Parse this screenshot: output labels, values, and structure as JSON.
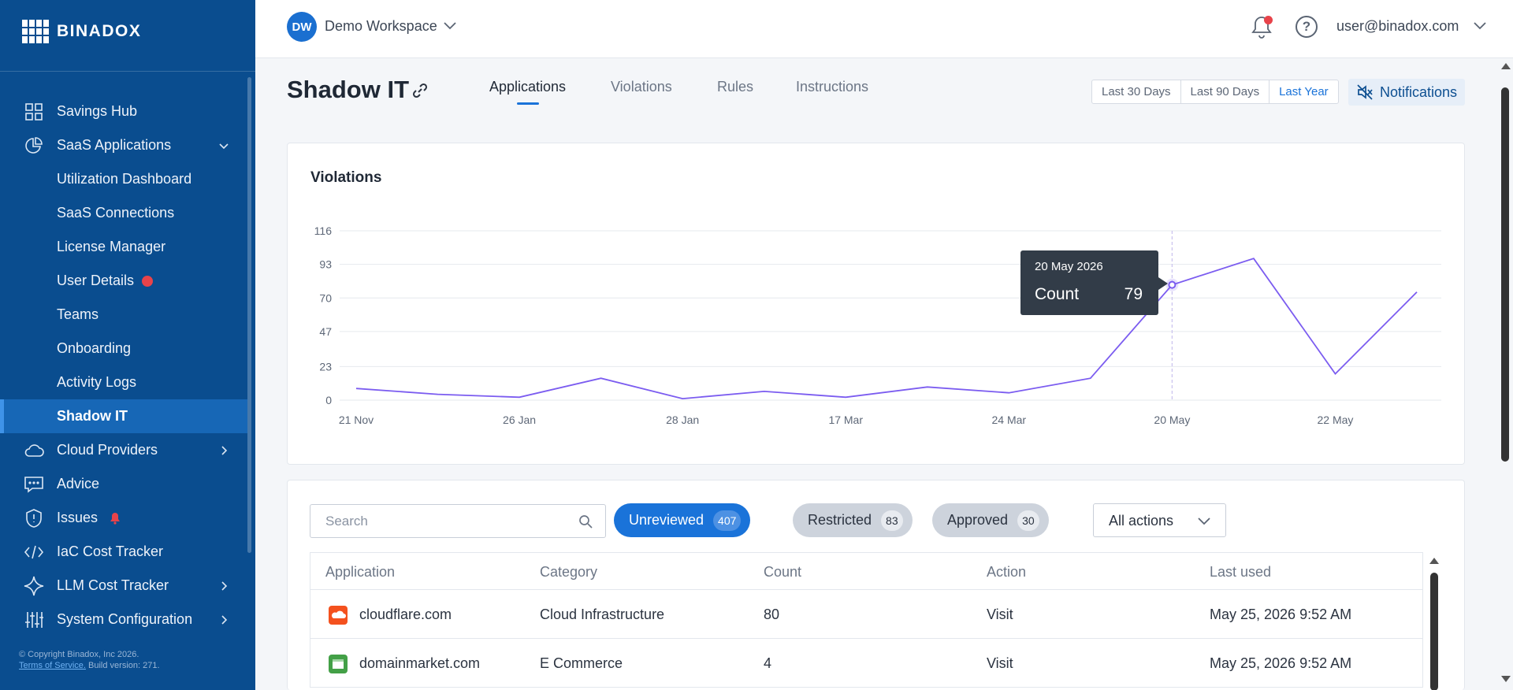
{
  "brand": {
    "name": "BINADOX"
  },
  "sidebar": {
    "items": [
      {
        "label": "Savings Hub",
        "icon": "grid-icon"
      },
      {
        "label": "SaaS Applications",
        "icon": "pie-chart-icon",
        "expanded": true
      },
      {
        "label": "Utilization Dashboard"
      },
      {
        "label": "SaaS Connections"
      },
      {
        "label": "License Manager"
      },
      {
        "label": "User Details",
        "badge": "red-dot"
      },
      {
        "label": "Teams"
      },
      {
        "label": "Onboarding"
      },
      {
        "label": "Activity Logs"
      },
      {
        "label": "Shadow IT",
        "active": true
      },
      {
        "label": "Cloud Providers",
        "icon": "cloud-icon"
      },
      {
        "label": "Advice",
        "icon": "chat-icon"
      },
      {
        "label": "Issues",
        "icon": "shield-alert-icon",
        "badge": "bell"
      },
      {
        "label": "IaC Cost Tracker",
        "icon": "code-icon"
      },
      {
        "label": "LLM Cost Tracker",
        "icon": "sparkle-icon"
      },
      {
        "label": "System Configuration",
        "icon": "sliders-icon"
      }
    ],
    "footer": {
      "copyright": "© Copyright Binadox, Inc 2026.",
      "terms": "Terms of Service.",
      "build": "Build version: 271."
    }
  },
  "topbar": {
    "workspace_initials": "DW",
    "workspace_name": "Demo Workspace",
    "user_email": "user@binadox.com",
    "help_glyph": "?"
  },
  "page": {
    "title": "Shadow IT",
    "tabs": [
      "Applications",
      "Violations",
      "Rules",
      "Instructions"
    ],
    "active_tab": "Applications",
    "ranges": [
      "Last 30 Days",
      "Last 90 Days",
      "Last Year"
    ],
    "active_range": "Last Year",
    "notifications_label": "Notifications"
  },
  "chart_data": {
    "type": "line",
    "title": "Violations",
    "yticks": [
      0,
      23,
      47,
      70,
      93,
      116
    ],
    "ylim": [
      0,
      116
    ],
    "x": [
      "21 Nov",
      "",
      "26 Jan",
      "",
      "28 Jan",
      "",
      "17 Mar",
      "",
      "24 Mar",
      "",
      "20 May",
      "",
      "22 May",
      ""
    ],
    "xtick_labels": [
      "21 Nov",
      "26 Jan",
      "28 Jan",
      "17 Mar",
      "24 Mar",
      "20 May",
      "22 May"
    ],
    "series": [
      {
        "values": [
          8,
          4,
          2,
          15,
          1,
          6,
          2,
          9,
          5,
          15,
          79,
          97,
          18,
          74
        ],
        "color": "#7b5cf0"
      }
    ],
    "grid": true,
    "tooltip": {
      "date": "20 May 2026",
      "label": "Count",
      "value": "79"
    }
  },
  "table_section": {
    "search_placeholder": "Search",
    "filters": [
      {
        "label": "Unreviewed",
        "count": "407"
      },
      {
        "label": "Restricted",
        "count": "83"
      },
      {
        "label": "Approved",
        "count": "30"
      }
    ],
    "actions_select": "All actions",
    "columns": [
      "Application",
      "Category",
      "Count",
      "Action",
      "Last used"
    ],
    "rows": [
      {
        "app": "cloudflare.com",
        "category": "Cloud Infrastructure",
        "count": "80",
        "action": "Visit",
        "last_used": "May 25, 2026 9:52 AM",
        "icon_color": "#f4511e"
      },
      {
        "app": "domainmarket.com",
        "category": "E Commerce",
        "count": "4",
        "action": "Visit",
        "last_used": "May 25, 2026 9:52 AM",
        "icon_color": "#43a047"
      }
    ]
  }
}
